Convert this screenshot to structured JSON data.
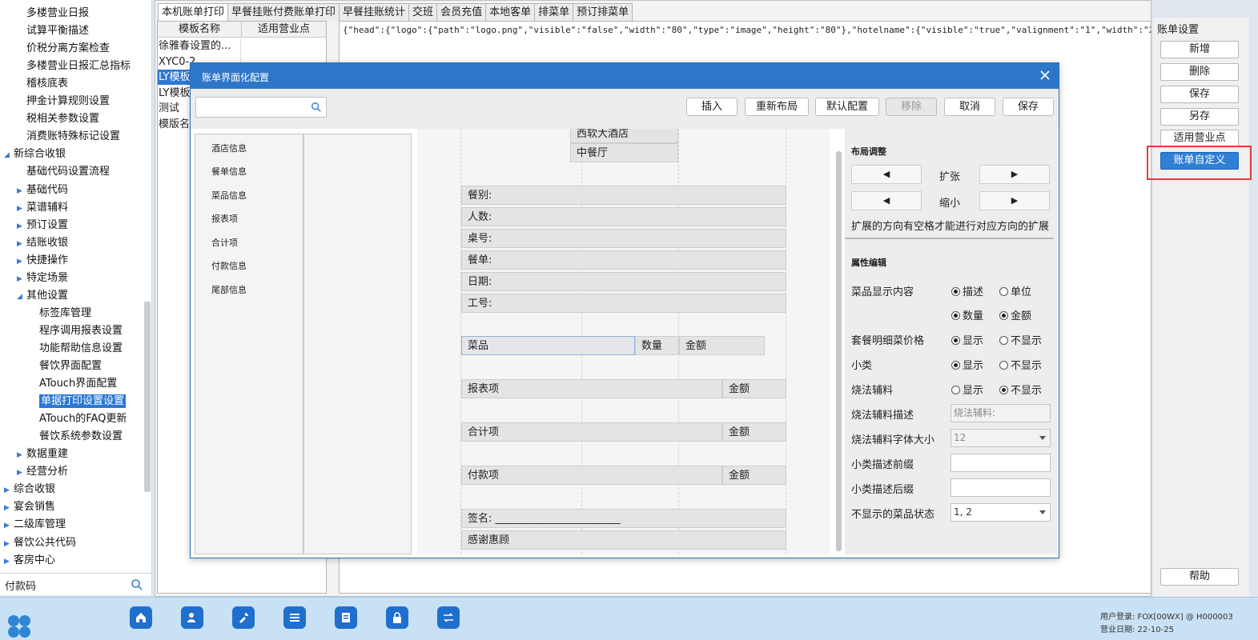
{
  "tree": {
    "items": [
      {
        "label": "多楼营业日报",
        "indent": 2,
        "arrow": ""
      },
      {
        "label": "试算平衡描述",
        "indent": 2,
        "arrow": ""
      },
      {
        "label": "价税分离方案检查",
        "indent": 2,
        "arrow": ""
      },
      {
        "label": "多楼营业日报汇总指标",
        "indent": 2,
        "arrow": ""
      },
      {
        "label": "稽核底表",
        "indent": 2,
        "arrow": ""
      },
      {
        "label": "押金计算规则设置",
        "indent": 2,
        "arrow": ""
      },
      {
        "label": "税相关参数设置",
        "indent": 2,
        "arrow": ""
      },
      {
        "label": "消费账特殊标记设置",
        "indent": 2,
        "arrow": ""
      },
      {
        "label": "新综合收银",
        "indent": 0,
        "arrow": "◢"
      },
      {
        "label": "基础代码设置流程",
        "indent": 2,
        "arrow": ""
      },
      {
        "label": "基础代码",
        "indent": 1,
        "arrow": "▶"
      },
      {
        "label": "菜谱辅料",
        "indent": 1,
        "arrow": "▶"
      },
      {
        "label": "预订设置",
        "indent": 1,
        "arrow": "▶"
      },
      {
        "label": "结账收银",
        "indent": 1,
        "arrow": "▶"
      },
      {
        "label": "快捷操作",
        "indent": 1,
        "arrow": "▶"
      },
      {
        "label": "特定场景",
        "indent": 1,
        "arrow": "▶"
      },
      {
        "label": "其他设置",
        "indent": 1,
        "arrow": "◢"
      },
      {
        "label": "标签库管理",
        "indent": 3,
        "arrow": ""
      },
      {
        "label": "程序调用报表设置",
        "indent": 3,
        "arrow": ""
      },
      {
        "label": "功能帮助信息设置",
        "indent": 3,
        "arrow": ""
      },
      {
        "label": "餐饮界面配置",
        "indent": 3,
        "arrow": ""
      },
      {
        "label": "ATouch界面配置",
        "indent": 3,
        "arrow": ""
      },
      {
        "label": "单据打印设置设置",
        "indent": 3,
        "arrow": "",
        "selected": true
      },
      {
        "label": "ATouch的FAQ更新",
        "indent": 3,
        "arrow": ""
      },
      {
        "label": "餐饮系统参数设置",
        "indent": 3,
        "arrow": ""
      },
      {
        "label": "数据重建",
        "indent": 1,
        "arrow": "▶"
      },
      {
        "label": "经营分析",
        "indent": 1,
        "arrow": "▶"
      },
      {
        "label": "综合收银",
        "indent": 0,
        "arrow": "▶"
      },
      {
        "label": "宴会销售",
        "indent": 0,
        "arrow": "▶"
      },
      {
        "label": "二级库管理",
        "indent": 0,
        "arrow": "▶"
      },
      {
        "label": "餐饮公共代码",
        "indent": 0,
        "arrow": "▶"
      },
      {
        "label": "客房中心",
        "indent": 0,
        "arrow": "▶"
      }
    ],
    "search_value": "付款码"
  },
  "tabs": [
    "本机账单打印",
    "早餐挂账付费账单打印",
    "早餐挂账统计",
    "交班",
    "会员充值",
    "本地客单",
    "排菜单",
    "预订排菜单"
  ],
  "template_table": {
    "headers": [
      "模板名称",
      "适用营业点"
    ],
    "rows": [
      {
        "name": "徐雅春设置的...",
        "selected": false
      },
      {
        "name": "XYC0-2",
        "selected": false
      },
      {
        "name": "LY模板",
        "selected": true
      },
      {
        "name": "LY模板",
        "selected": false
      },
      {
        "name": "测试",
        "selected": false
      },
      {
        "name": "模版名称",
        "selected": false
      }
    ]
  },
  "json_text": "{\"head\":{\"logo\":{\"path\":\"logo.png\",\"visible\":\"false\",\"width\":\"80\",\"type\":\"image\",\"height\":\"80\"},\"hotelname\":{\"visible\":\"true\",\"valignment\":\"1\",\"width\":\"2",
  "settings": {
    "title": "账单设置",
    "buttons": [
      "新增",
      "删除",
      "保存",
      "另存",
      "适用营业点",
      "账单自定义"
    ],
    "help": "帮助"
  },
  "modal": {
    "title": "账单界面化配置",
    "toolbar": {
      "insert": "插入",
      "relayout": "重新布局",
      "default": "默认配置",
      "remove": "移除",
      "cancel": "取消",
      "save": "保存"
    },
    "categories": [
      "酒店信息",
      "餐单信息",
      "菜品信息",
      "报表项",
      "合计项",
      "付款信息",
      "尾部信息"
    ],
    "fields": {
      "hotel": "西软大酒店",
      "outlet": "中餐厅",
      "meal": "餐别:",
      "people": "人数:",
      "table": "桌号:",
      "order": "餐单:",
      "date": "日期:",
      "staff": "工号:",
      "dish": "菜品",
      "qty": "数量",
      "amount": "金额",
      "report": "报表项",
      "report_amt": "金额",
      "total": "合计项",
      "total_amt": "金额",
      "pay": "付款项",
      "pay_amt": "金额",
      "sign": "签名: ________________________",
      "thanks": "感谢惠顾"
    },
    "props": {
      "layout_title": "布局调整",
      "expand": "扩张",
      "shrink": "缩小",
      "layout_hint": "扩展的方向有空格才能进行对应方向的扩展",
      "edit_title": "属性编辑",
      "dish_display": "菜品显示内容",
      "opt_desc": "描述",
      "opt_unit": "单位",
      "opt_qty": "数量",
      "opt_amount": "金额",
      "set_price": "套餐明细菜价格",
      "show": "显示",
      "hide": "不显示",
      "subclass": "小类",
      "cook_aux": "烧法辅料",
      "cook_desc": "烧法辅料描述",
      "cook_desc_val": "烧法辅料:",
      "cook_font": "烧法辅料字体大小",
      "cook_font_val": "12",
      "sub_prefix": "小类描述前缀",
      "sub_suffix": "小类描述后缀",
      "hidden_status": "不显示的菜品状态",
      "hidden_status_val": "1, 2"
    }
  },
  "status": {
    "user": "用户登录:  FOX[00WX] @ H000003",
    "date": "营业日期:  22-10-25"
  },
  "colors": {
    "accent": "#2e77c8",
    "highlight": "#e23b3b",
    "selection": "#2b78d6"
  }
}
